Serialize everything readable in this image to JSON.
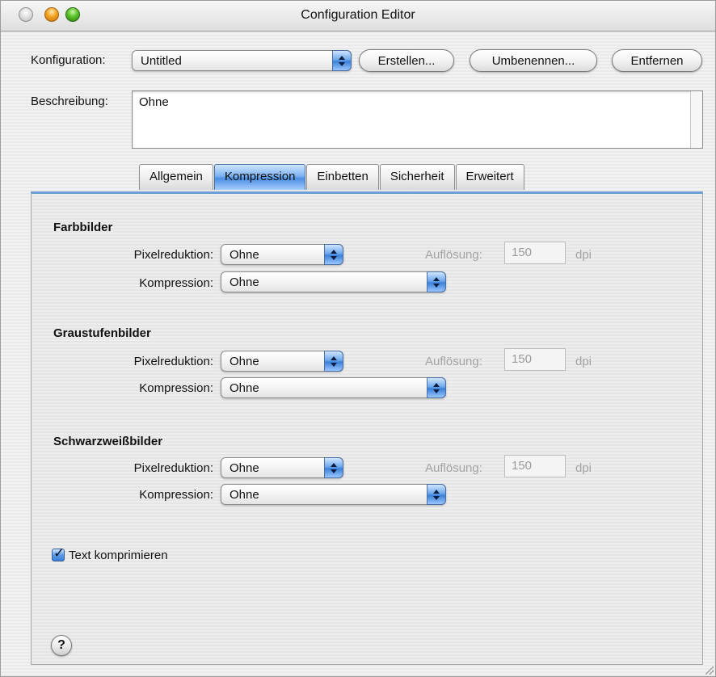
{
  "window": {
    "title": "Configuration Editor"
  },
  "config": {
    "label": "Konfiguration:",
    "selected": "Untitled",
    "buttons": {
      "create": "Erstellen...",
      "rename": "Umbenennen...",
      "remove": "Entfernen"
    }
  },
  "description": {
    "label": "Beschreibung:",
    "value": "Ohne"
  },
  "tabs": [
    {
      "label": "Allgemein",
      "active": false
    },
    {
      "label": "Kompression",
      "active": true
    },
    {
      "label": "Einbetten",
      "active": false
    },
    {
      "label": "Sicherheit",
      "active": false
    },
    {
      "label": "Erweitert",
      "active": false
    }
  ],
  "sections": [
    {
      "title": "Farbbilder",
      "downsample_label": "Pixelreduktion:",
      "downsample_value": "Ohne",
      "resolution_label": "Auflösung:",
      "resolution_value": "150",
      "resolution_unit": "dpi",
      "compression_label": "Kompression:",
      "compression_value": "Ohne"
    },
    {
      "title": "Graustufenbilder",
      "downsample_label": "Pixelreduktion:",
      "downsample_value": "Ohne",
      "resolution_label": "Auflösung:",
      "resolution_value": "150",
      "resolution_unit": "dpi",
      "compression_label": "Kompression:",
      "compression_value": "Ohne"
    },
    {
      "title": "Schwarzweißbilder",
      "downsample_label": "Pixelreduktion:",
      "downsample_value": "Ohne",
      "resolution_label": "Auflösung:",
      "resolution_value": "150",
      "resolution_unit": "dpi",
      "compression_label": "Kompression:",
      "compression_value": "Ohne"
    }
  ],
  "text_compress": {
    "label": "Text komprimieren",
    "checked": true
  },
  "help": {
    "glyph": "?"
  },
  "colors": {
    "accent": "#4a8ee3",
    "tab_border": "#6c9fd6"
  }
}
